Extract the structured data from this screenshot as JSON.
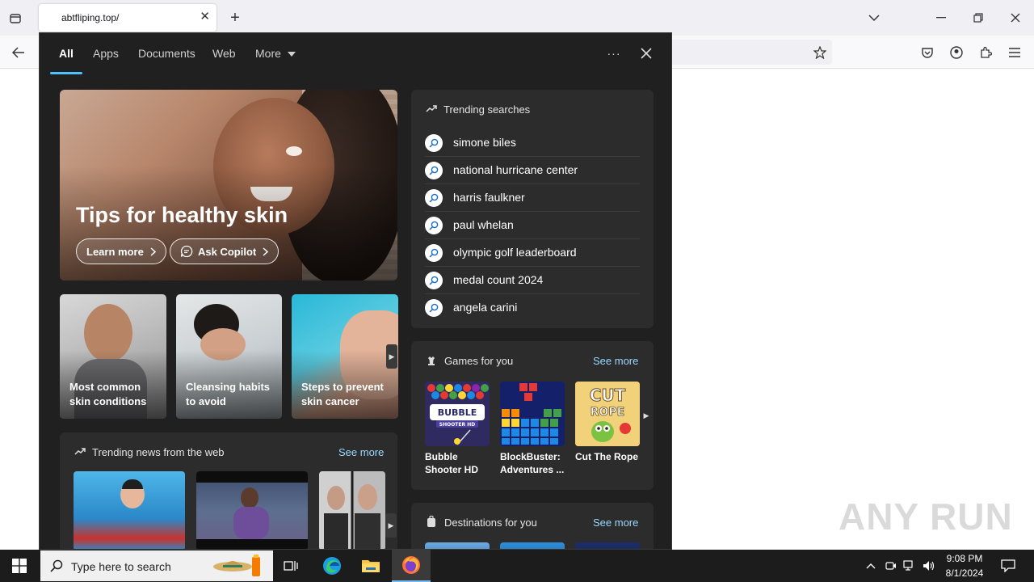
{
  "browser": {
    "tab_title": "abtfliping.top/",
    "new_tab_symbol": "+"
  },
  "panel": {
    "tabs": [
      "All",
      "Apps",
      "Documents",
      "Web",
      "More"
    ],
    "hero": {
      "title": "Tips for healthy skin",
      "learn_more": "Learn more",
      "ask_copilot": "Ask Copilot"
    },
    "cards": [
      {
        "label": "Most common skin conditions"
      },
      {
        "label": "Cleansing habits to avoid"
      },
      {
        "label": "Steps to prevent skin cancer"
      }
    ],
    "trending": {
      "title": "Trending searches",
      "items": [
        "simone biles",
        "national hurricane center",
        "harris faulkner",
        "paul whelan",
        "olympic golf leaderboard",
        "medal count 2024",
        "angela carini"
      ]
    },
    "games": {
      "title": "Games for you",
      "see_more": "See more",
      "items": [
        {
          "label": "Bubble Shooter HD"
        },
        {
          "label": "BlockBuster: Adventures ..."
        },
        {
          "label": "Cut The Rope"
        }
      ]
    },
    "news": {
      "title": "Trending news from the web",
      "see_more": "See more"
    },
    "destinations": {
      "title": "Destinations for you",
      "see_more": "See more"
    }
  },
  "taskbar": {
    "search_placeholder": "Type here to search",
    "time": "9:08 PM",
    "date": "8/1/2024"
  },
  "watermark": "ANY RUN",
  "colors": {
    "panel_bg": "#202020",
    "box_bg": "#2c2c2c",
    "accent": "#4cc2ff",
    "link": "#99d9ff"
  }
}
